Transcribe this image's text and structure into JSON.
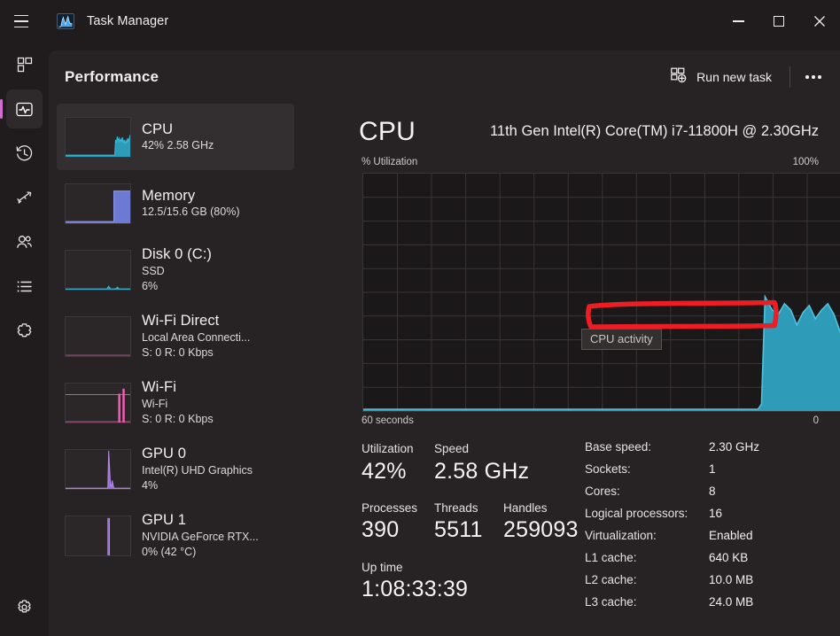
{
  "window": {
    "title": "Task Manager",
    "app_icon": "task-manager-chart-icon",
    "minimize_label": "Minimize",
    "maximize_label": "Maximize",
    "close_label": "Close",
    "menu_label": "Open navigation"
  },
  "rail": {
    "items": [
      {
        "name": "processes",
        "icon": "processes-grid-icon",
        "active": false
      },
      {
        "name": "performance",
        "icon": "performance-pulse-icon",
        "active": true
      },
      {
        "name": "app-history",
        "icon": "history-clock-icon",
        "active": false
      },
      {
        "name": "startup-apps",
        "icon": "startup-rocket-icon",
        "active": false
      },
      {
        "name": "users",
        "icon": "users-icon",
        "active": false
      },
      {
        "name": "details",
        "icon": "details-list-icon",
        "active": false
      },
      {
        "name": "services",
        "icon": "services-gear-icon",
        "active": false
      }
    ],
    "settings": {
      "name": "settings",
      "icon": "settings-gear-icon"
    }
  },
  "header": {
    "title": "Performance",
    "run_new_task_label": "Run new task",
    "run_new_task_icon": "run-new-task-icon",
    "more_label": "See more",
    "more_icon": "ellipsis-icon"
  },
  "perf_list": [
    {
      "title": "CPU",
      "sub1": "42%  2.58 GHz",
      "sub2": "",
      "color": "#2aa6c0",
      "selected": true
    },
    {
      "title": "Memory",
      "sub1": "12.5/15.6 GB (80%)",
      "sub2": "",
      "color": "#6d7ad4",
      "selected": false
    },
    {
      "title": "Disk 0 (C:)",
      "sub1": "SSD",
      "sub2": "6%",
      "color": "#2aa6c0",
      "selected": false
    },
    {
      "title": "Wi-Fi Direct",
      "sub1": "Local Area Connecti...",
      "sub2": "S: 0 R: 0 Kbps",
      "color": "#d664b0",
      "selected": false
    },
    {
      "title": "Wi-Fi",
      "sub1": "Wi-Fi",
      "sub2": "S: 0 R: 0 Kbps",
      "color": "#f05ab0",
      "selected": false
    },
    {
      "title": "GPU 0",
      "sub1": "Intel(R) UHD Graphics",
      "sub2": "4%",
      "color": "#9a6fd4",
      "selected": false
    },
    {
      "title": "GPU 1",
      "sub1": "NVIDIA GeForce RTX...",
      "sub2": "0%  (42 °C)",
      "color": "#9a6fd4",
      "selected": false
    }
  ],
  "pane": {
    "title": "CPU",
    "model": "11th Gen Intel(R) Core(TM) i7-11800H @ 2.30GHz",
    "axis_label_top_left": "% Utilization",
    "axis_label_top_right": "100%",
    "axis_label_bottom_left": "60 seconds",
    "axis_label_bottom_right": "0",
    "graph_tooltip": "CPU activity",
    "graph_color": "#3aa8c4"
  },
  "stats": {
    "left": [
      {
        "key": "Utilization",
        "value": "42%"
      },
      {
        "key": "Speed",
        "value": "2.58 GHz"
      },
      {
        "key": "Processes",
        "value": "390"
      },
      {
        "key": "Threads",
        "value": "5511"
      },
      {
        "key": "Handles",
        "value": "259093"
      },
      {
        "key": "Up time",
        "value": "1:08:33:39"
      }
    ],
    "right": [
      {
        "key": "Base speed:",
        "value": "2.30 GHz"
      },
      {
        "key": "Sockets:",
        "value": "1"
      },
      {
        "key": "Cores:",
        "value": "8"
      },
      {
        "key": "Logical processors:",
        "value": "16"
      },
      {
        "key": "Virtualization:",
        "value": "Enabled"
      },
      {
        "key": "L1 cache:",
        "value": "640 KB"
      },
      {
        "key": "L2 cache:",
        "value": "10.0 MB"
      },
      {
        "key": "L3 cache:",
        "value": "24.0 MB"
      }
    ]
  },
  "annotation": {
    "type": "red-rectangle-highlight",
    "target": "Virtualization: Enabled",
    "color": "#ee1d24"
  },
  "chart_data": {
    "type": "area",
    "title": "CPU activity",
    "xlabel": "60 seconds",
    "ylabel": "% Utilization",
    "ylim": [
      0,
      100
    ],
    "xlim": [
      60,
      0
    ],
    "grid": true,
    "x": [
      60,
      58,
      56,
      54,
      52,
      50,
      48,
      46,
      44,
      42,
      40,
      38,
      36,
      34,
      32,
      30,
      28,
      26,
      24,
      22,
      20,
      18,
      16,
      14,
      12,
      10,
      9,
      8.5,
      8,
      7.5,
      7,
      6.5,
      6,
      5.5,
      5,
      4.5,
      4,
      3.5,
      3,
      2.5,
      2,
      1.5,
      1,
      0.5,
      0
    ],
    "values": [
      0,
      0,
      0,
      0,
      0,
      0,
      0,
      0,
      0,
      0,
      0,
      0,
      0,
      0,
      0,
      0,
      0,
      0,
      0,
      0,
      0,
      0,
      0,
      0,
      0,
      0,
      2,
      48,
      41,
      37,
      44,
      39,
      30,
      38,
      42,
      34,
      38,
      44,
      41,
      38,
      31,
      22,
      20,
      26,
      48
    ],
    "series": [
      {
        "name": "CPU utilization",
        "color": "#3aa8c4",
        "fill": "#2e9bb8",
        "values": [
          0,
          0,
          0,
          0,
          0,
          0,
          0,
          0,
          0,
          0,
          0,
          0,
          0,
          0,
          0,
          0,
          0,
          0,
          0,
          0,
          0,
          0,
          0,
          0,
          0,
          0,
          2,
          48,
          41,
          37,
          44,
          39,
          30,
          38,
          42,
          34,
          38,
          44,
          41,
          38,
          31,
          22,
          20,
          26,
          48
        ]
      }
    ]
  }
}
